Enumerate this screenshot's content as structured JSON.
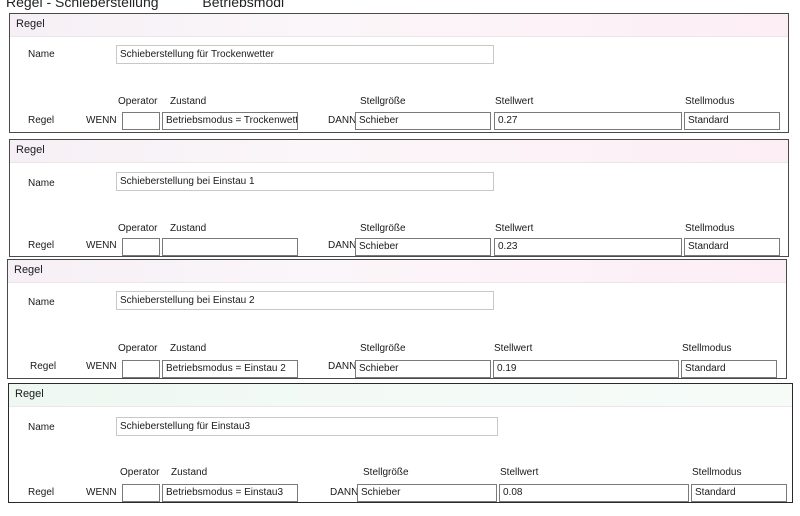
{
  "caption": {
    "left": "Regel - Schieberstellung",
    "right": "Betriebsmodi"
  },
  "labels": {
    "panel_title": "Regel",
    "name": "Name",
    "regel": "Regel",
    "wenn": "WENN",
    "dann": "DANN",
    "operator": "Operator",
    "zustand": "Zustand",
    "stellgroesse": "Stellgröße",
    "stellwert": "Stellwert",
    "stellmodus": "Stellmodus"
  },
  "rules": [
    {
      "name": "Schieberstellung für Trockenwetter",
      "operator": "",
      "zustand": "Betriebsmodus = Trockenwetter",
      "stellgroesse": "Schieber",
      "stellwert": "0.27",
      "stellmodus": "Standard"
    },
    {
      "name": "Schieberstellung bei Einstau 1",
      "operator": "",
      "zustand": "",
      "stellgroesse": "Schieber",
      "stellwert": "0.23",
      "stellmodus": "Standard"
    },
    {
      "name": "Schieberstellung bei Einstau 2",
      "operator": "",
      "zustand": "Betriebsmodus = Einstau 2",
      "stellgroesse": "Schieber",
      "stellwert": "0.19",
      "stellmodus": "Standard"
    },
    {
      "name": "Schieberstellung für Einstau3",
      "operator": "",
      "zustand": "Betriebsmodus = Einstau3",
      "stellgroesse": "Schieber",
      "stellwert": "0.08",
      "stellmodus": "Standard"
    }
  ],
  "colors": {
    "header_pink": "#fbf1f6",
    "header_green": "#f1f9f4",
    "border": "#4a4a4a"
  }
}
